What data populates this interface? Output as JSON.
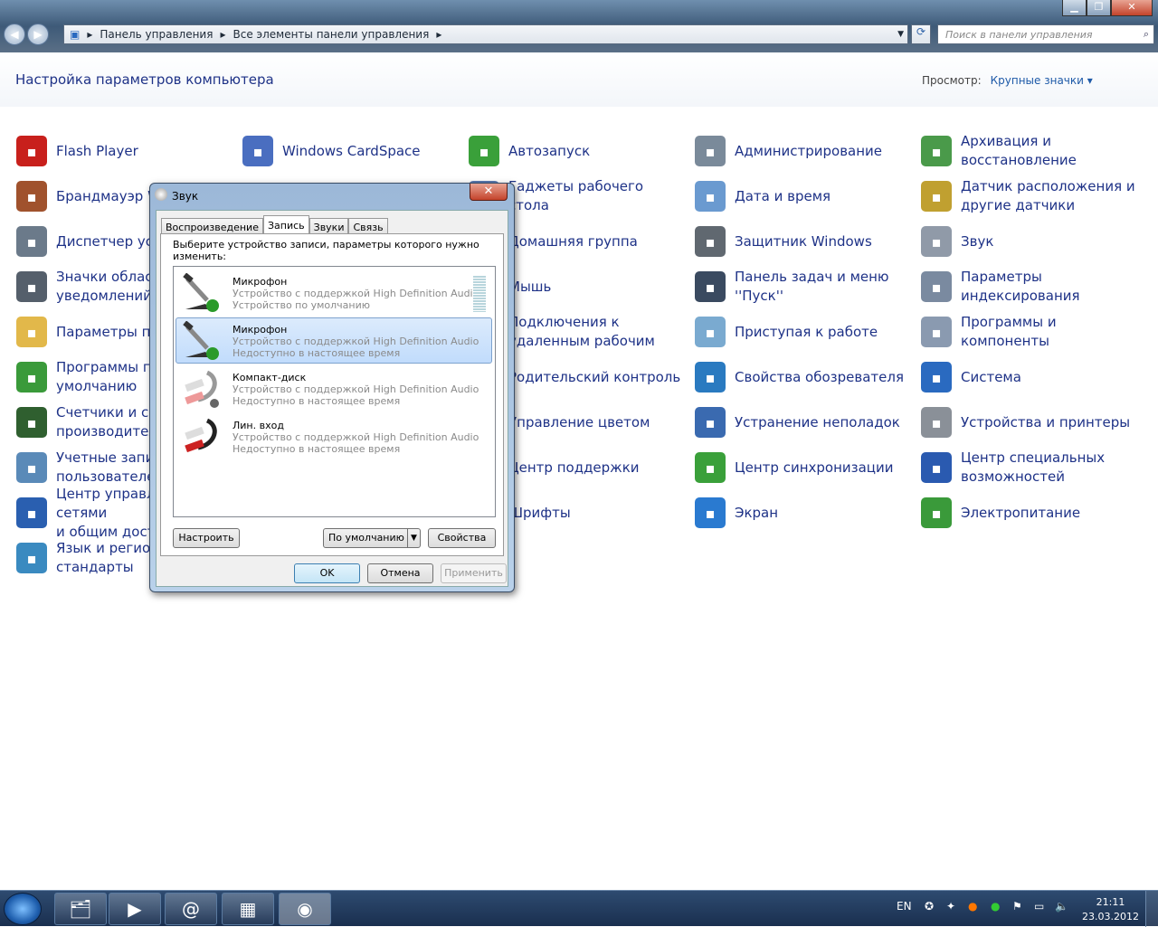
{
  "window": {
    "minimize": "▁",
    "maximize": "❐",
    "close": "✕"
  },
  "address": {
    "crumbs": [
      "Панель управления",
      "Все элементы панели управления"
    ],
    "search_placeholder": "Поиск в панели управления"
  },
  "header": {
    "title": "Настройка параметров компьютера",
    "view_label": "Просмотр:",
    "view_value": "Крупные значки ▾"
  },
  "columns": [
    [
      {
        "label": "Flash Player",
        "icon": "flash-icon",
        "color": "#c8201c"
      },
      {
        "label": "Брандмауэр Windows",
        "icon": "firewall-icon",
        "color": "#a0522d"
      },
      {
        "label": "Диспетчер устройств",
        "icon": "device-manager-icon",
        "color": "#6b7a8a"
      },
      {
        "label": "Значки области\nуведомлений",
        "icon": "tray-icon",
        "color": "#555f6b"
      },
      {
        "label": "Параметры папок",
        "icon": "folder-icon",
        "color": "#e2b84a"
      },
      {
        "label": "Программы по\nумолчанию",
        "icon": "default-programs-icon",
        "color": "#3a9a3a"
      },
      {
        "label": "Счетчики и средства\nпроизводительности",
        "icon": "performance-icon",
        "color": "#2f5f2f"
      },
      {
        "label": "Учетные записи\nпользователей",
        "icon": "users-icon",
        "color": "#5a8ab8"
      },
      {
        "label": "Центр управления сетями\nи общим доступом",
        "icon": "network-icon",
        "color": "#2a5fb0"
      },
      {
        "label": "Язык и региональные\nстандарты",
        "icon": "globe-clock-icon",
        "color": "#3a8ac0"
      }
    ],
    [
      {
        "label": "Windows CardSpace",
        "icon": "cardspace-icon",
        "color": "#4a6ec0"
      }
    ],
    [
      {
        "label": "Автозапуск",
        "icon": "autoplay-icon",
        "color": "#3aa03a"
      },
      {
        "label": "Гаджеты рабочего стола",
        "icon": "gadgets-icon",
        "color": "#5a7ab0"
      },
      {
        "label": "Домашняя группа",
        "icon": "homegroup-icon",
        "color": "#3a8ad0"
      },
      {
        "label": "Мышь",
        "icon": "mouse-icon",
        "color": "#888"
      },
      {
        "label": "Подключения к\nудаленным рабочим",
        "icon": "remote-icon",
        "color": "#4a7ab0"
      },
      {
        "label": "Родительский контроль",
        "icon": "parental-icon",
        "color": "#d08a30"
      },
      {
        "label": "Управление цветом",
        "icon": "color-icon",
        "color": "#c04ab0"
      },
      {
        "label": "Центр поддержки",
        "icon": "flag-icon",
        "color": "#3a6ab0"
      },
      {
        "label": "Шрифты",
        "icon": "fonts-icon",
        "color": "#c0a040"
      }
    ],
    [
      {
        "label": "Администрирование",
        "icon": "admin-tools-icon",
        "color": "#7a8a9a"
      },
      {
        "label": "Дата и время",
        "icon": "calendar-icon",
        "color": "#6a9ad0"
      },
      {
        "label": "Защитник Windows",
        "icon": "defender-icon",
        "color": "#606870"
      },
      {
        "label": "Панель задач и меню\n''Пуск''",
        "icon": "taskbar-icon",
        "color": "#3a4a60"
      },
      {
        "label": "Приступая к работе",
        "icon": "getting-started-icon",
        "color": "#7aaad0"
      },
      {
        "label": "Свойства обозревателя",
        "icon": "internet-options-icon",
        "color": "#2a7ac0"
      },
      {
        "label": "Устранение неполадок",
        "icon": "troubleshoot-icon",
        "color": "#3a6ab0"
      },
      {
        "label": "Центр синхронизации",
        "icon": "sync-icon",
        "color": "#3aa03a"
      },
      {
        "label": "Экран",
        "icon": "display-icon",
        "color": "#2a7ad0"
      }
    ],
    [
      {
        "label": "Архивация и\nвосстановление",
        "icon": "backup-icon",
        "color": "#4a9a4a"
      },
      {
        "label": "Датчик расположения и\nдругие датчики",
        "icon": "sensor-icon",
        "color": "#c0a030"
      },
      {
        "label": "Звук",
        "icon": "speaker-icon",
        "color": "#909aa8"
      },
      {
        "label": "Параметры\nиндексирования",
        "icon": "indexing-icon",
        "color": "#7a8aa0"
      },
      {
        "label": "Программы и\nкомпоненты",
        "icon": "programs-icon",
        "color": "#8a9ab0"
      },
      {
        "label": "Система",
        "icon": "system-icon",
        "color": "#2a6ac0"
      },
      {
        "label": "Устройства и принтеры",
        "icon": "printer-icon",
        "color": "#8a9098"
      },
      {
        "label": "Центр специальных\nвозможностей",
        "icon": "accessibility-icon",
        "color": "#2a5ab0"
      },
      {
        "label": "Электропитание",
        "icon": "power-icon",
        "color": "#3a9a3a"
      }
    ]
  ],
  "dialog": {
    "title": "Звук",
    "close": "✕",
    "tabs": [
      {
        "label": "Воспроизведение",
        "active": false
      },
      {
        "label": "Запись",
        "active": true
      },
      {
        "label": "Звуки",
        "active": false
      },
      {
        "label": "Связь",
        "active": false
      }
    ],
    "prompt": "Выберите устройство записи, параметры которого нужно изменить:",
    "devices": [
      {
        "name": "Микрофон",
        "line1": "Устройство с поддержкой High Definition Audio",
        "line2": "Устройство по умолчанию",
        "icon": "microphone-default-icon",
        "selected": false,
        "level": 0
      },
      {
        "name": "Микрофон",
        "line1": "Устройство с поддержкой High Definition Audio",
        "line2": "Недоступно в настоящее время",
        "icon": "microphone-communication-icon",
        "selected": true
      },
      {
        "name": "Компакт-диск",
        "line1": "Устройство с поддержкой High Definition Audio",
        "line2": "Недоступно в настоящее время",
        "icon": "cd-audio-cable-icon",
        "selected": false
      },
      {
        "name": "Лин. вход",
        "line1": "Устройство с поддержкой High Definition Audio",
        "line2": "Недоступно в настоящее время",
        "icon": "line-in-cable-icon",
        "selected": false
      }
    ],
    "buttons": {
      "configure": "Настроить",
      "set_default": "По умолчанию",
      "properties": "Свойства",
      "ok": "OK",
      "cancel": "Отмена",
      "apply": "Применить"
    }
  },
  "taskbar": {
    "apps": [
      "explorer",
      "media-player",
      "mail-agent",
      "control-panel",
      "sound"
    ],
    "lang": "EN",
    "time": "21:11",
    "date": "23.03.2012"
  }
}
